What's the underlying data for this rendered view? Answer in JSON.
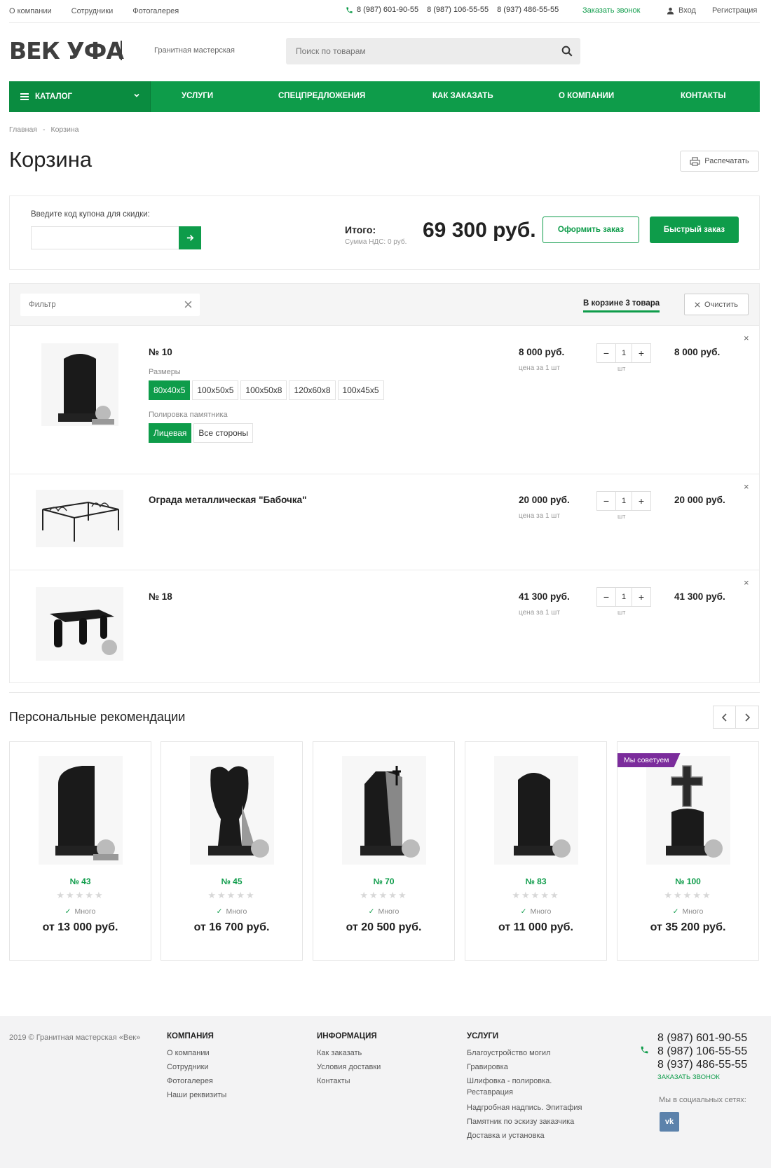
{
  "topbar": {
    "links": [
      "О компании",
      "Сотрудники",
      "Фотогалерея"
    ],
    "phones": [
      "8 (987) 601-90-55",
      "8 (987) 106-55-55",
      "8 (937) 486-55-55"
    ],
    "callback": "Заказать звонок",
    "login": "Вход",
    "register": "Регистрация"
  },
  "header": {
    "logo": "ВЕК УФА",
    "tagline": "Гранитная мастерская",
    "search_placeholder": "Поиск по товарам"
  },
  "nav": {
    "catalog": "КАТАЛОГ",
    "items": [
      "УСЛУГИ",
      "СПЕЦПРЕДЛОЖЕНИЯ",
      "КАК ЗАКАЗАТЬ",
      "О КОМПАНИИ",
      "КОНТАКТЫ"
    ]
  },
  "breadcrumb": [
    "Главная",
    "Корзина"
  ],
  "breadcrumb_sep": "-",
  "page_title": "Корзина",
  "print_label": "Распечатать",
  "totals": {
    "coupon_label": "Введите код купона для скидки:",
    "itogo": "Итого:",
    "vat": "Сумма НДС: 0 руб.",
    "sum": "69 300 руб.",
    "order_button": "Оформить заказ",
    "quick_button": "Быстрый заказ"
  },
  "cart": {
    "filter_placeholder": "Фильтр",
    "count_label": "В корзине 3 товара",
    "clear_label": "Очистить",
    "per_unit": "цена за 1 шт",
    "unit": "шт",
    "items": [
      {
        "name": "№ 10",
        "price": "8 000 руб.",
        "qty": "1",
        "total": "8 000 руб.",
        "props": [
          {
            "label": "Размеры",
            "options": [
              "80х40х5",
              "100х50х5",
              "100х50х8",
              "120х60х8",
              "100х45х5"
            ],
            "selected": "80х40х5"
          },
          {
            "label": "Полировка памятника",
            "options": [
              "Лицевая",
              "Все стороны"
            ],
            "selected": "Лицевая"
          }
        ]
      },
      {
        "name": "Ограда металлическая \"Бабочка\"",
        "price": "20 000 руб.",
        "qty": "1",
        "total": "20 000 руб.",
        "props": []
      },
      {
        "name": "№ 18",
        "price": "41 300 руб.",
        "qty": "1",
        "total": "41 300 руб.",
        "props": []
      }
    ]
  },
  "recommendations": {
    "title": "Персональные рекомендации",
    "badge": "Мы советуем",
    "stock": "Много",
    "items": [
      {
        "name": "№ 43",
        "price": "от 13 000 руб."
      },
      {
        "name": "№ 45",
        "price": "от 16 700 руб."
      },
      {
        "name": "№ 70",
        "price": "от 20 500 руб."
      },
      {
        "name": "№ 83",
        "price": "от 11 000 руб."
      },
      {
        "name": "№ 100",
        "price": "от 35 200 руб."
      }
    ]
  },
  "footer": {
    "copyright": "2019 © Гранитная мастерская «Век»",
    "company": {
      "title": "Компания",
      "links": [
        "О компании",
        "Сотрудники",
        "Фотогалерея",
        "Наши реквизиты"
      ]
    },
    "info": {
      "title": "Информация",
      "links": [
        "Как заказать",
        "Условия доставки",
        "Контакты"
      ]
    },
    "services": {
      "title": "Услуги",
      "links": [
        "Благоустройство могил",
        "Гравировка",
        "Шлифовка - полировка. Реставрация",
        "Надгробная надпись. Эпитафия",
        "Памятник по эскизу заказчика",
        "Доставка и установка"
      ]
    },
    "phones": [
      "8 (987) 601-90-55",
      "8 (987) 106-55-55",
      "8 (937) 486-55-55"
    ],
    "callback": "ЗАКАЗАТЬ ЗВОНОК",
    "social_label": "Мы в социальных сетях:",
    "vk": "vk"
  },
  "colors": {
    "brand_green": "#0e9c4a",
    "badge_purple": "#7b2c9c",
    "vk_blue": "#5c82ab"
  },
  "icons": [
    "phone-icon",
    "user-icon",
    "search-icon",
    "menu-icon",
    "chevron-down-icon",
    "printer-icon",
    "arrow-right-icon",
    "close-icon",
    "minus-icon",
    "plus-icon",
    "chevron-left-icon",
    "chevron-right-icon",
    "check-icon",
    "star-icon",
    "vk-icon"
  ]
}
